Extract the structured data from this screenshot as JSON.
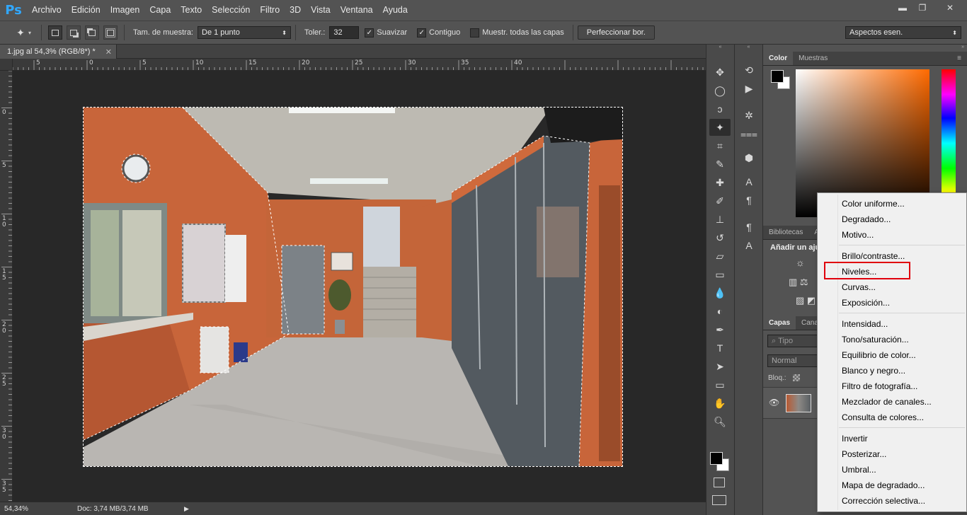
{
  "app": {
    "logo": "Ps"
  },
  "menu": [
    "Archivo",
    "Edición",
    "Imagen",
    "Capa",
    "Texto",
    "Selección",
    "Filtro",
    "3D",
    "Vista",
    "Ventana",
    "Ayuda"
  ],
  "window_controls": {
    "minimize_icon": "minimize-icon",
    "restore_icon": "restore-icon",
    "close_icon": "close-icon"
  },
  "options": {
    "sample_size_label": "Tam. de muestra:",
    "sample_size_value": "De 1 punto",
    "tolerance_label": "Toler.:",
    "tolerance_value": "32",
    "antialias_label": "Suavizar",
    "contiguous_label": "Contiguo",
    "all_layers_label": "Muestr. todas las capas",
    "refine_button": "Perfeccionar bor.",
    "workspace": "Aspectos esen."
  },
  "document": {
    "tab_title": "1.jpg al 54,3% (RGB/8*) *",
    "zoom": "54,34%",
    "doc_info": "Doc: 3,74 MB/3,74 MB"
  },
  "rulers": {
    "h_labels": [
      "5",
      "0",
      "5",
      "10",
      "15",
      "20",
      "25",
      "30",
      "35",
      "40"
    ],
    "v_labels": [
      "0",
      "5",
      "1\n0",
      "1\n5",
      "2\n0",
      "2\n5",
      "3\n0",
      "3\n5"
    ]
  },
  "color_panel": {
    "tabs": [
      "Color",
      "Muestras"
    ],
    "fg": "#000000",
    "bg": "#ffffff"
  },
  "libraries_panel": {
    "tabs": [
      "Bibliotecas",
      "A"
    ],
    "adjust_label": "Añadir un aju"
  },
  "layers_panel": {
    "tabs": [
      "Capas",
      "Canale"
    ],
    "search_placeholder": "Tipo",
    "blend_mode": "Normal",
    "lock_label": "Bloq.:"
  },
  "dropdown_menu": {
    "groups": [
      [
        "Color uniforme...",
        "Degradado...",
        "Motivo..."
      ],
      [
        "Brillo/contraste...",
        "Niveles...",
        "Curvas...",
        "Exposición..."
      ],
      [
        "Intensidad...",
        "Tono/saturación...",
        "Equilibrio de color...",
        "Blanco y negro...",
        "Filtro de fotografía...",
        "Mezclador de canales...",
        "Consulta de colores..."
      ],
      [
        "Invertir",
        "Posterizar...",
        "Umbral...",
        "Mapa de degradado...",
        "Corrección selectiva..."
      ]
    ],
    "highlighted": "Niveles...",
    "highlight_color": "#e0000c"
  },
  "colors": {
    "ui_bg": "#535353",
    "canvas_bg": "#282828",
    "wall": "#c8653a"
  }
}
